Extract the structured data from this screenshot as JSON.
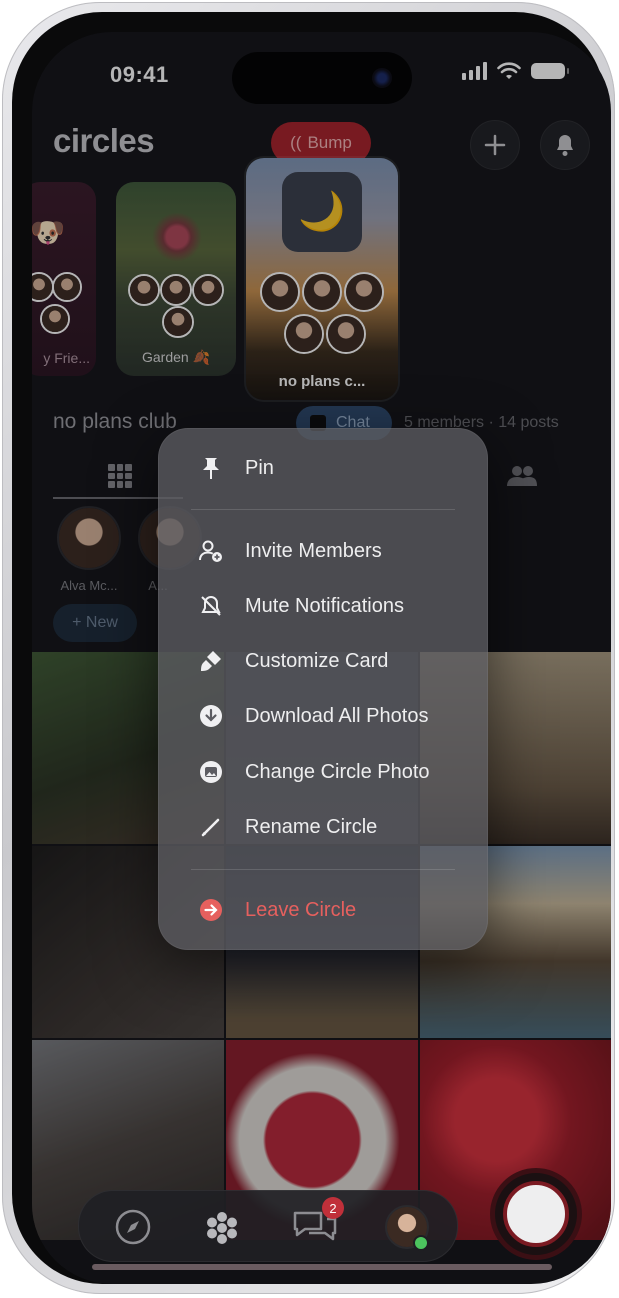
{
  "status": {
    "time": "09:41"
  },
  "header": {
    "title": "circles",
    "bump_label": "Bump"
  },
  "cards": [
    {
      "label": "y Frie...",
      "emoji": "🐶"
    },
    {
      "label": "Garden",
      "emoji": "🍂"
    },
    {
      "label": "no plans c...",
      "emoji": "🌙"
    }
  ],
  "circle": {
    "name": "no plans club",
    "chat_label": "Chat",
    "stats": "5 members  ·  14 posts"
  },
  "members": [
    {
      "name": "Alva Mc..."
    },
    {
      "name": "A..."
    }
  ],
  "new_label": "+ New",
  "menu": {
    "items": [
      {
        "label": "Pin",
        "icon": "pin-icon"
      },
      {
        "label": "Invite Members",
        "icon": "add-person-icon"
      },
      {
        "label": "Mute Notifications",
        "icon": "bell-off-icon"
      },
      {
        "label": "Customize Card",
        "icon": "brush-icon"
      },
      {
        "label": "Download All Photos",
        "icon": "download-icon"
      },
      {
        "label": "Change Circle Photo",
        "icon": "photo-icon"
      },
      {
        "label": "Rename Circle",
        "icon": "pencil-icon"
      },
      {
        "label": "Leave Circle",
        "icon": "leave-icon"
      }
    ]
  },
  "tabbar": {
    "chat_badge": "2"
  },
  "colors": {
    "accent": "#a8212a",
    "leave": "#e6605e",
    "background": "#131417"
  }
}
